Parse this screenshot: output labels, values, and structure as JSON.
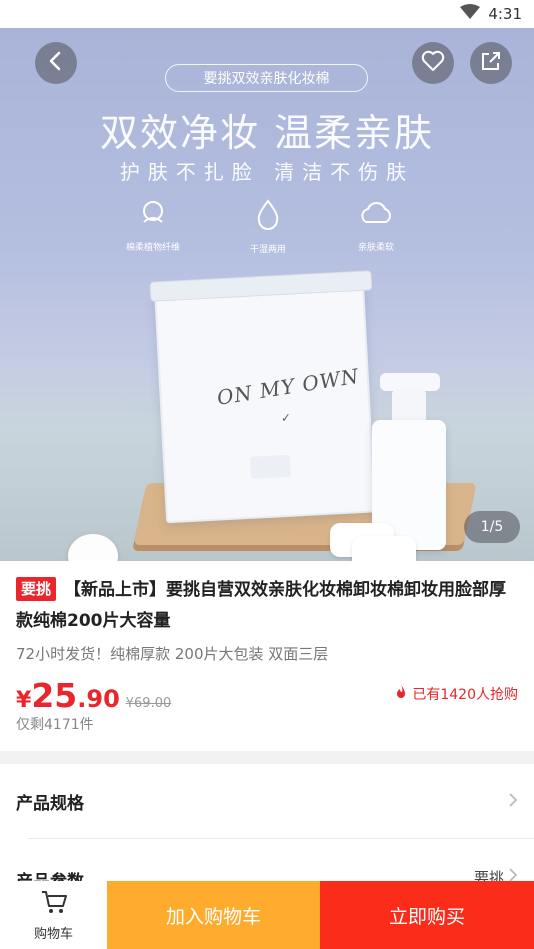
{
  "status_bar": {
    "time": "4:31"
  },
  "hero": {
    "tag": "要挑双效亲肤化妆棉",
    "headline": "双效净妆 温柔亲肤",
    "subline": "护肤不扎脸 清洁不伤肤",
    "features": [
      {
        "icon": "cotton-flower-icon",
        "label": "棉柔植物纤维"
      },
      {
        "icon": "water-drop-icon",
        "label": "干湿两用"
      },
      {
        "icon": "cloud-soft-icon",
        "label": "亲肤柔软"
      }
    ],
    "product_brand": "ON MY OWN",
    "pager": "1/5"
  },
  "product": {
    "badge": "要挑",
    "title": "【新品上市】要挑自营双效亲肤化妆棉卸妆棉卸妆用脸部厚款纯棉200片大容量",
    "subtitle": "72小时发货！纯棉厚款 200片大包装 双面三层",
    "price_currency": "¥",
    "price_integer": "25",
    "price_decimal": ".90",
    "original_price": "¥69.00",
    "sold_text": "已有1420人抢购",
    "stock_text": "仅剩4171件"
  },
  "specs": {
    "row1_label": "产品规格",
    "row2_label": "产品参数",
    "row2_value": "要挑"
  },
  "bottom_bar": {
    "cart_label": "购物车",
    "add_to_cart": "加入购物车",
    "buy_now": "立即购买"
  },
  "colors": {
    "accent_red": "#e8262c",
    "add_cart_orange": "#ffab2e",
    "buy_red": "#fb2d1a"
  }
}
